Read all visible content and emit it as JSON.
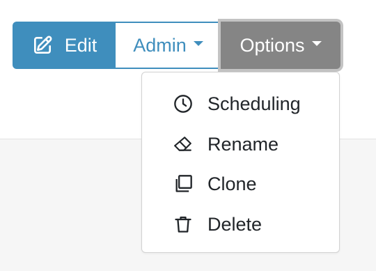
{
  "toolbar": {
    "edit_label": "Edit",
    "admin_label": "Admin",
    "options_label": "Options"
  },
  "options_menu": {
    "items": [
      {
        "label": "Scheduling",
        "icon": "clock-icon"
      },
      {
        "label": "Rename",
        "icon": "eraser-icon"
      },
      {
        "label": "Clone",
        "icon": "copy-icon"
      },
      {
        "label": "Delete",
        "icon": "trash-icon"
      }
    ]
  },
  "colors": {
    "primary": "#3f8ebd",
    "secondary_active": "#858585",
    "focus_ring": "#c3c3c3",
    "panel_bg": "#f6f6f6",
    "menu_text": "#212529"
  }
}
